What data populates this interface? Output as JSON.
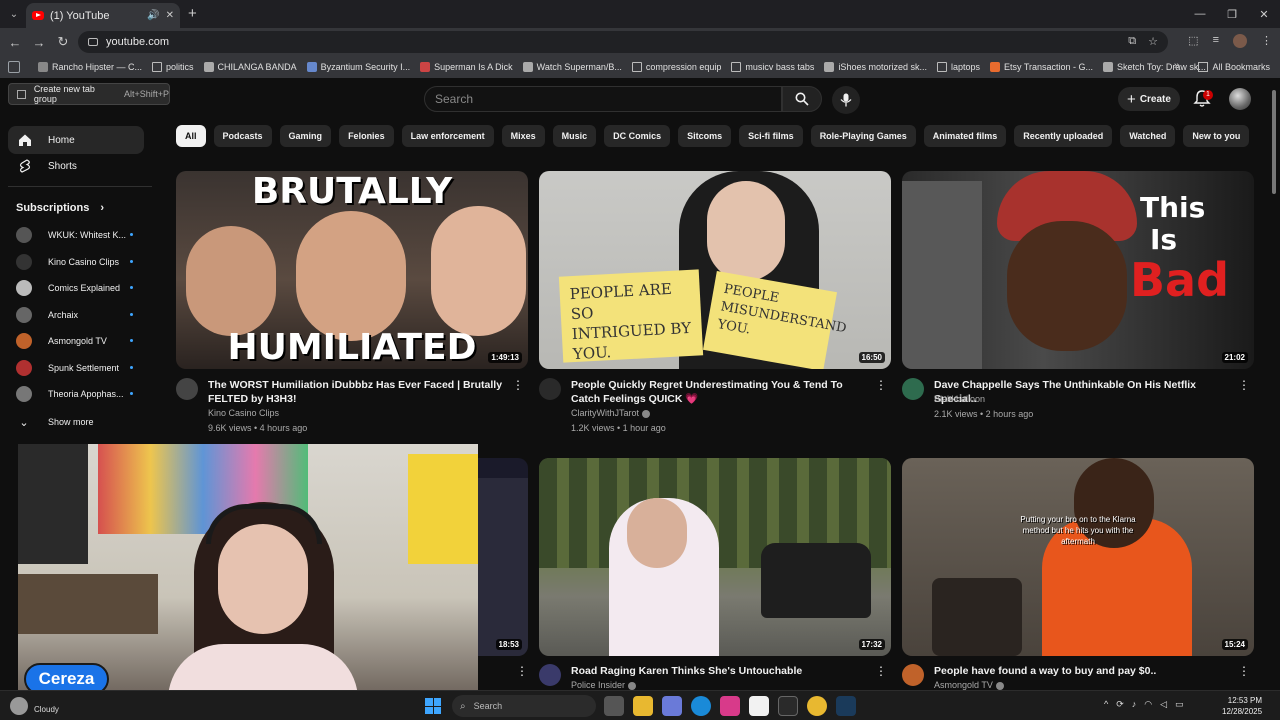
{
  "browser": {
    "tab_title": "(1) YouTube",
    "url": "youtube.com",
    "bookmarks": [
      {
        "label": "Rancho Hipster — C...",
        "color": "#888888"
      },
      {
        "label": "politics",
        "color": "folder"
      },
      {
        "label": "CHILANGA BANDA",
        "color": "#aaaaaa"
      },
      {
        "label": "Byzantium Security I...",
        "color": "#6688cc"
      },
      {
        "label": "Superman Is A Dick",
        "color": "#cc4444"
      },
      {
        "label": "Watch Superman/B...",
        "color": "#aaaaaa"
      },
      {
        "label": "compression equip",
        "color": "folder"
      },
      {
        "label": "musicv bass tabs",
        "color": "folder"
      },
      {
        "label": "iShoes motorized sk...",
        "color": "#aaaaaa"
      },
      {
        "label": "laptops",
        "color": "folder"
      },
      {
        "label": "Etsy Transaction - G...",
        "color": "#e86b2e"
      },
      {
        "label": "Sketch Toy: Draw sk...",
        "color": "#aaaaaa"
      }
    ],
    "all_bookmarks": "All Bookmarks",
    "tooltip_label": "Create new tab group",
    "tooltip_shortcut": "Alt+Shift+P"
  },
  "header": {
    "search_placeholder": "Search",
    "create_label": "Create",
    "notification_count": "1"
  },
  "sidebar": {
    "home": "Home",
    "shorts": "Shorts",
    "subscriptions_title": "Subscriptions",
    "subscriptions": [
      {
        "name": "WKUK: Whitest K...",
        "color": "#555555"
      },
      {
        "name": "Kino Casino Clips",
        "color": "#333333"
      },
      {
        "name": "Comics Explained",
        "color": "#bbbbbb"
      },
      {
        "name": "Archaix",
        "color": "#666666"
      },
      {
        "name": "Asmongold TV",
        "color": "#c0622a"
      },
      {
        "name": "Spunk Settlement",
        "color": "#b03030"
      },
      {
        "name": "Theoria Apophas...",
        "color": "#777777"
      }
    ],
    "show_more": "Show more"
  },
  "chips": [
    "All",
    "Podcasts",
    "Gaming",
    "Felonies",
    "Law enforcement",
    "Mixes",
    "Music",
    "DC Comics",
    "Sitcoms",
    "Sci-fi films",
    "Role-Playing Games",
    "Animated films",
    "Recently uploaded",
    "Watched",
    "New to you"
  ],
  "videos": [
    {
      "title": "The WORST Humiliation iDubbbz Has Ever Faced | Brutally FELTED by H3H3!",
      "channel": "Kino Casino Clips",
      "stats": "9.6K views • 4 hours ago",
      "duration": "1:49:13",
      "thumb_top": "BRUTALLY",
      "thumb_bottom": "HUMILIATED"
    },
    {
      "title": "People Quickly Regret Underestimating You & Tend To Catch Feelings QUICK 💗",
      "channel": "ClarityWithJTarot",
      "stats": "1.2K views • 1 hour ago",
      "duration": "16:50",
      "note1": "PEOPLE ARE SO INTRIGUED BY YOU.",
      "note2": "PEOPLE MISUNDERSTAND YOU."
    },
    {
      "title": "Dave Chappelle Says The Unthinkable On His Netflix Special..",
      "channel": "Blakkballoon",
      "stats": "2.1K views • 2 hours ago",
      "duration": "21:02",
      "thumb_line1": "This",
      "thumb_line2": "Is",
      "thumb_line3": "Bad"
    },
    {
      "title": "",
      "channel": "",
      "stats": "",
      "duration": "18:53"
    },
    {
      "title": "Road Raging Karen Thinks She's Untouchable",
      "channel": "Police Insider",
      "stats": "",
      "duration": "17:32"
    },
    {
      "title": "People have found a way to buy and pay $0..",
      "channel": "Asmongold TV",
      "stats": "",
      "duration": "15:24",
      "caption": "Putting your bro on to the Klarna method but he hits you with the aftermath"
    }
  ],
  "overlay": {
    "streamer_name": "Cereza"
  },
  "taskbar": {
    "weather": "Cloudy",
    "search": "Search",
    "time": "12:53 PM",
    "date": "12/28/2025"
  }
}
